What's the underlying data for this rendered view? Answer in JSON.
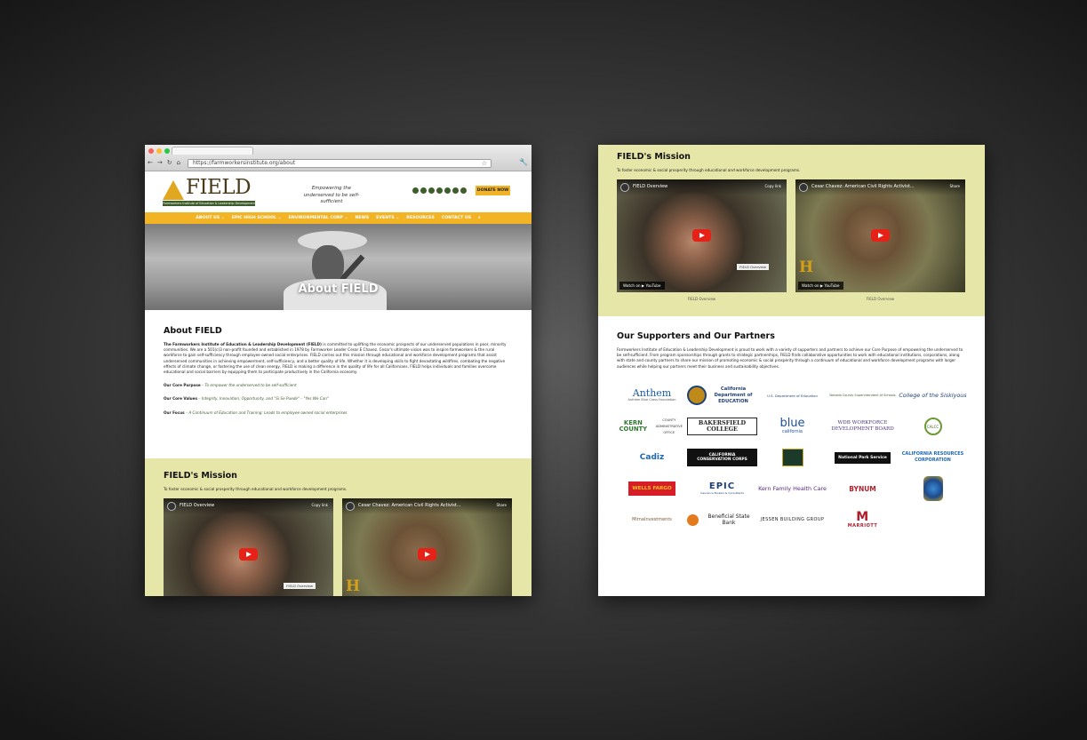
{
  "browser": {
    "url": "https://farmworkersinstitute.org/about",
    "back_glyph": "←",
    "forward_glyph": "→",
    "reload_glyph": "↻",
    "home_glyph": "⌂",
    "star_glyph": "☆",
    "menu_glyph": "🔧"
  },
  "header": {
    "logo_text": "FIELD",
    "logo_subtext": "Farmworkers Institute of Education & Leadership Development",
    "tagline": "Empowering the underserved to be self-sufficient",
    "donate_label": "DONATE NOW",
    "social_icons": [
      "facebook-icon",
      "twitter-icon",
      "youtube-icon",
      "instagram-icon",
      "linkedin-icon",
      "flickr-icon",
      "tiktok-icon"
    ]
  },
  "nav": {
    "items": [
      "ABOUT US ⌄",
      "EPIC HIGH SCHOOL ⌄",
      "ENVIRONMENTAL CORP ⌄",
      "NEWS",
      "EVENTS ⌄",
      "RESOURCES",
      "CONTACT US"
    ],
    "search_glyph": "⌕"
  },
  "hero": {
    "title": "About FIELD"
  },
  "about": {
    "heading": "About FIELD",
    "org_name": "The Farmworkers Institute of Education & Leadership Development (FIELD)",
    "paragraph": " is committed to uplifting the economic prospects of our underserved populations in poor, minority communities. We are a 501(c)3 non-profit founded and established in 1978 by Farmworker Leader Cesar E Chavez. Cesar's ultimate vision was to inspire farmworkers & the rural workforce to gain self-sufficiency through employee owned social enterprises. FIELD carries out this mission through educational and workforce development programs that assist underserved communities in achieving empowerment, self-sufficiency, and a better quality of life. Whether it is developing skills to fight devastating wildfires, combating the negative effects of climate change, or fostering the use of clean energy, FIELD is making a difference in the quality of life for all Californians. FIELD helps individuals and families overcome educational and social barriers by equipping them to participate productively in the California economy.",
    "purpose_label": "Our Core Purpose",
    "purpose_text": " – To empower the underserved to be self-sufficient",
    "values_label": "Our Core Values",
    "values_text": " – Integrity, Innovation, Opportunity, and \"Sí Se Puede\" – \"Yes We Can\"",
    "focus_label": "Our Focus",
    "focus_text": " – A Continuum of Education and Training: Leads to employee owned social enterprises"
  },
  "mission": {
    "heading": "FIELD's Mission",
    "text": "To foster economic & social prosperity through educational and workforce development programs.",
    "videos": [
      {
        "title": "FIELD Overview",
        "action": "Copy link",
        "badge": "FIELD Overview",
        "watch": "Watch on ▶ YouTube",
        "caption": "FIELD Overview"
      },
      {
        "title": "Cesar Chavez: American Civil Rights Activist...",
        "action": "Share",
        "badge": "",
        "watch": "Watch on ▶ YouTube",
        "caption": "FIELD Overview"
      }
    ]
  },
  "partners": {
    "heading": "Our Supporters and Our Partners",
    "text": "Farmworkers Institute of Education & Leadership Development is proud to work with a variety of supporters and partners to achieve our Core Purpose of empowering the underserved to be self-sufficient. From program sponsorships through grants to strategic partnerships, FIELD finds collaborative opportunities to work with educational institutions, corporations, along with state and county partners to share our mission of promoting economic & social prosperity through a continuum of educational and workforce development programs with larger audiences while helping our partners meet their business and sustainability objectives.",
    "logos": {
      "anthem": "Anthem",
      "anthem_sub": "Anthem Blue Cross Foundation",
      "cde": "California Department of EDUCATION",
      "usde": "U.S. Department of Education",
      "nevada": "Nevada County Superintendent of Schools",
      "siskiyous": "College of the Siskiyous",
      "kern": "KERN COUNTY",
      "kern_sub": "COUNTY ADMINISTRATIVE OFFICE",
      "bakersfield": "BAKERSFIELD COLLEGE",
      "blue": "blue",
      "blue_sub": "california",
      "wdb": "WDB WORKFORCE DEVELOPMENT BOARD",
      "calcc": "CALCC",
      "cadiz": "Cadiz",
      "ccc": "CALIFORNIA CONSERVATION CORPS",
      "nps": "National Park Service",
      "crc": "CALIFORNIA RESOURCES CORPORATION",
      "wellsfargo": "WELLS FARGO",
      "epic": "EPIC",
      "epic_sub": "Insurance Brokers & Consultants",
      "kernfamily": "Kern Family Health Care",
      "bynum": "BYNUM",
      "mirna": "MirnaInvestments",
      "bsb": "Beneficial State Bank",
      "jessen": "JESSEN BUILDING GROUP",
      "marriott": "MARRIOTT",
      "marriott_glyph": "M"
    }
  },
  "colors": {
    "accent": "#f2b424",
    "green": "#3d5b2a",
    "mission_bg": "#e6e6a9"
  }
}
